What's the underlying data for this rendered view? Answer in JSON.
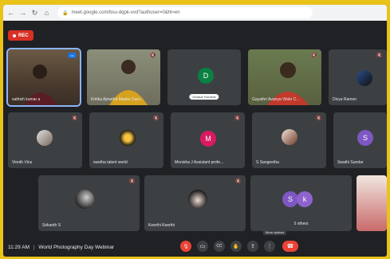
{
  "browser": {
    "url": "meet.google.com/bsu-dqpk-xvd?authuser=0&hl=en",
    "nav_icons": [
      "back-icon",
      "forward-icon",
      "reload-icon",
      "home-icon"
    ]
  },
  "recording": {
    "label": "REC"
  },
  "participants": [
    {
      "name": "sathish kumar a",
      "type": "video",
      "speaking": true,
      "speaking_label": "•••"
    },
    {
      "name": "Kritika Ajmatha Maske Caro...",
      "type": "video",
      "muted": true
    },
    {
      "name": "Divakar Ronalds",
      "type": "avatar",
      "initial": "D",
      "color": "#0b8043",
      "pill": true
    },
    {
      "name": "Gayathri Avanya Vilokr C...",
      "type": "video",
      "muted": true
    },
    {
      "name": "Divya Ramen",
      "type": "photo",
      "muted": true
    },
    {
      "name": "Vinoth Vinu",
      "type": "photo",
      "muted": true
    },
    {
      "name": "swetha talent world",
      "type": "photo",
      "muted": true
    },
    {
      "name": "Monisha J Assistant profe...",
      "type": "avatar",
      "initial": "M",
      "color": "#d81b60",
      "muted": true
    },
    {
      "name": "S Sangeetha",
      "type": "photo",
      "muted": true
    },
    {
      "name": "Swathi Sundar",
      "type": "avatar",
      "initial": "S",
      "color": "#7e57c2",
      "muted": true
    },
    {
      "name": "Srikanth S",
      "type": "photo",
      "muted": true
    },
    {
      "name": "Keerthi Keerthi",
      "type": "photo",
      "muted": true
    },
    {
      "name": "6 others",
      "type": "group",
      "initials": [
        "S",
        "k"
      ],
      "colors": [
        "#7e57c2",
        "#8e63ce"
      ]
    },
    {
      "name": "",
      "type": "video-partial"
    }
  ],
  "toolbar": {
    "time": "11:29 AM",
    "separator": "|",
    "meeting_title": "World Photography Day Webinar",
    "tooltip": "More options",
    "buttons": [
      {
        "name": "mic-off-button",
        "icon": "mic-off-icon",
        "glyph": "🎙"
      },
      {
        "name": "camera-button",
        "icon": "camera-icon",
        "glyph": "▭"
      },
      {
        "name": "captions-button",
        "icon": "captions-icon",
        "glyph": "CC"
      },
      {
        "name": "raise-hand-button",
        "icon": "hand-icon",
        "glyph": "✋"
      },
      {
        "name": "present-button",
        "icon": "present-icon",
        "glyph": "⇪"
      },
      {
        "name": "more-options-button",
        "icon": "more-vert-icon",
        "glyph": "⋮"
      },
      {
        "name": "end-call-button",
        "icon": "end-call-icon",
        "glyph": "☎"
      }
    ]
  },
  "colors": {
    "background": "#202124",
    "tile": "#3c4043",
    "accent": "#1a73e8",
    "danger": "#ea4335"
  }
}
